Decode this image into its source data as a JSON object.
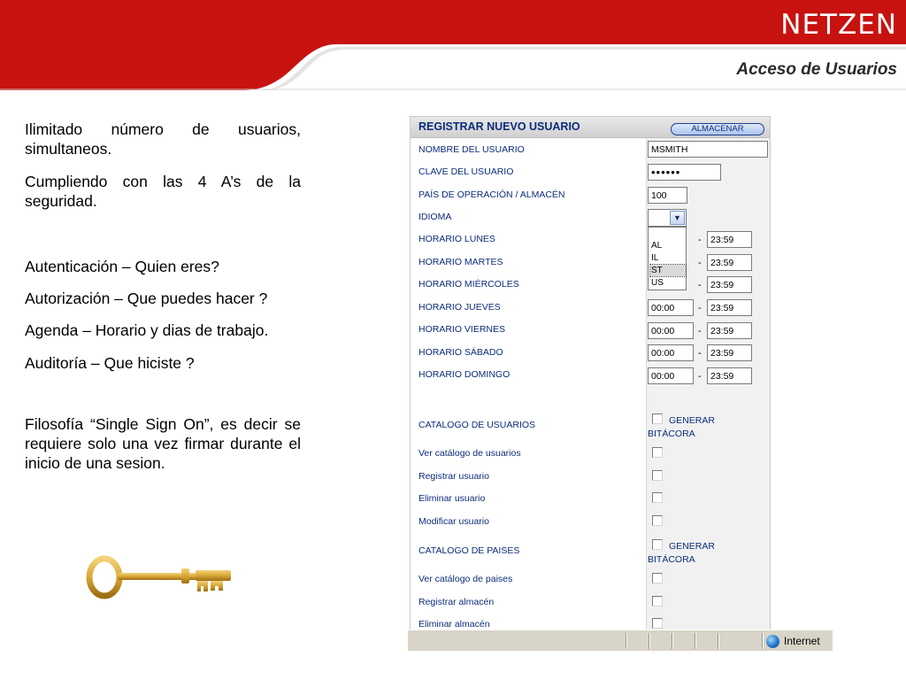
{
  "header": {
    "brand": "NETZEN",
    "section_title": "Acceso de Usuarios"
  },
  "left_text": {
    "p1": "Ilimitado número de usuarios, simultaneos.",
    "p2": "Cumpliendo con las 4 A’s de la seguridad.",
    "p3": "Autenticación – Quien eres?",
    "p4": "Autorización – Que puedes hacer ?",
    "p5": "Agenda – Horario y dias de trabajo.",
    "p6": "Auditoría – Que hiciste ?",
    "p7": "Filosofía “Single Sign On”, es decir se requiere solo una vez firmar durante el inicio de una sesion."
  },
  "form": {
    "title": "REGISTRAR NUEVO USUARIO",
    "store_button": "ALMACENAR",
    "labels": {
      "username": "NOMBRE DEL USUARIO",
      "password": "CLAVE DEL USUARIO",
      "country": "PAÍS DE OPERACIÓN / ALMACÉN",
      "language": "IDIOMA",
      "monday": "HORARIO LUNES",
      "tuesday": "HORARIO MARTES",
      "wednesday": "HORARIO MIÉRCOLES",
      "thursday": "HORARIO JUEVES",
      "friday": "HORARIO VIERNES",
      "saturday": "HORARIO SÁBADO",
      "sunday": "HORARIO DOMINGO",
      "user_catalog": "CATALOGO DE USUARIOS",
      "view_users": "Ver catálogo de usuarios",
      "register_user": "Registrar usuario",
      "delete_user": "Eliminar usuario",
      "modify_user": "Modificar usuario",
      "country_catalog": "CATALOGO DE PAISES",
      "view_countries": "Ver catálogo de paises",
      "register_store": "Registrar almacén",
      "delete_store": "Eliminar almacén"
    },
    "values": {
      "username": "MSMITH",
      "password": "••••••",
      "country": "100",
      "start": "00:00",
      "end": "23:59",
      "dash": "-"
    },
    "language_options": [
      "AL",
      "IL",
      "ST",
      "US"
    ],
    "language_selected": "ST",
    "generate_log": "GENERAR BITÁCORA"
  },
  "statusbar": {
    "zone": "Internet"
  },
  "colors": {
    "brand_red": "#c8120f",
    "label_blue": "#0b2c7a"
  }
}
